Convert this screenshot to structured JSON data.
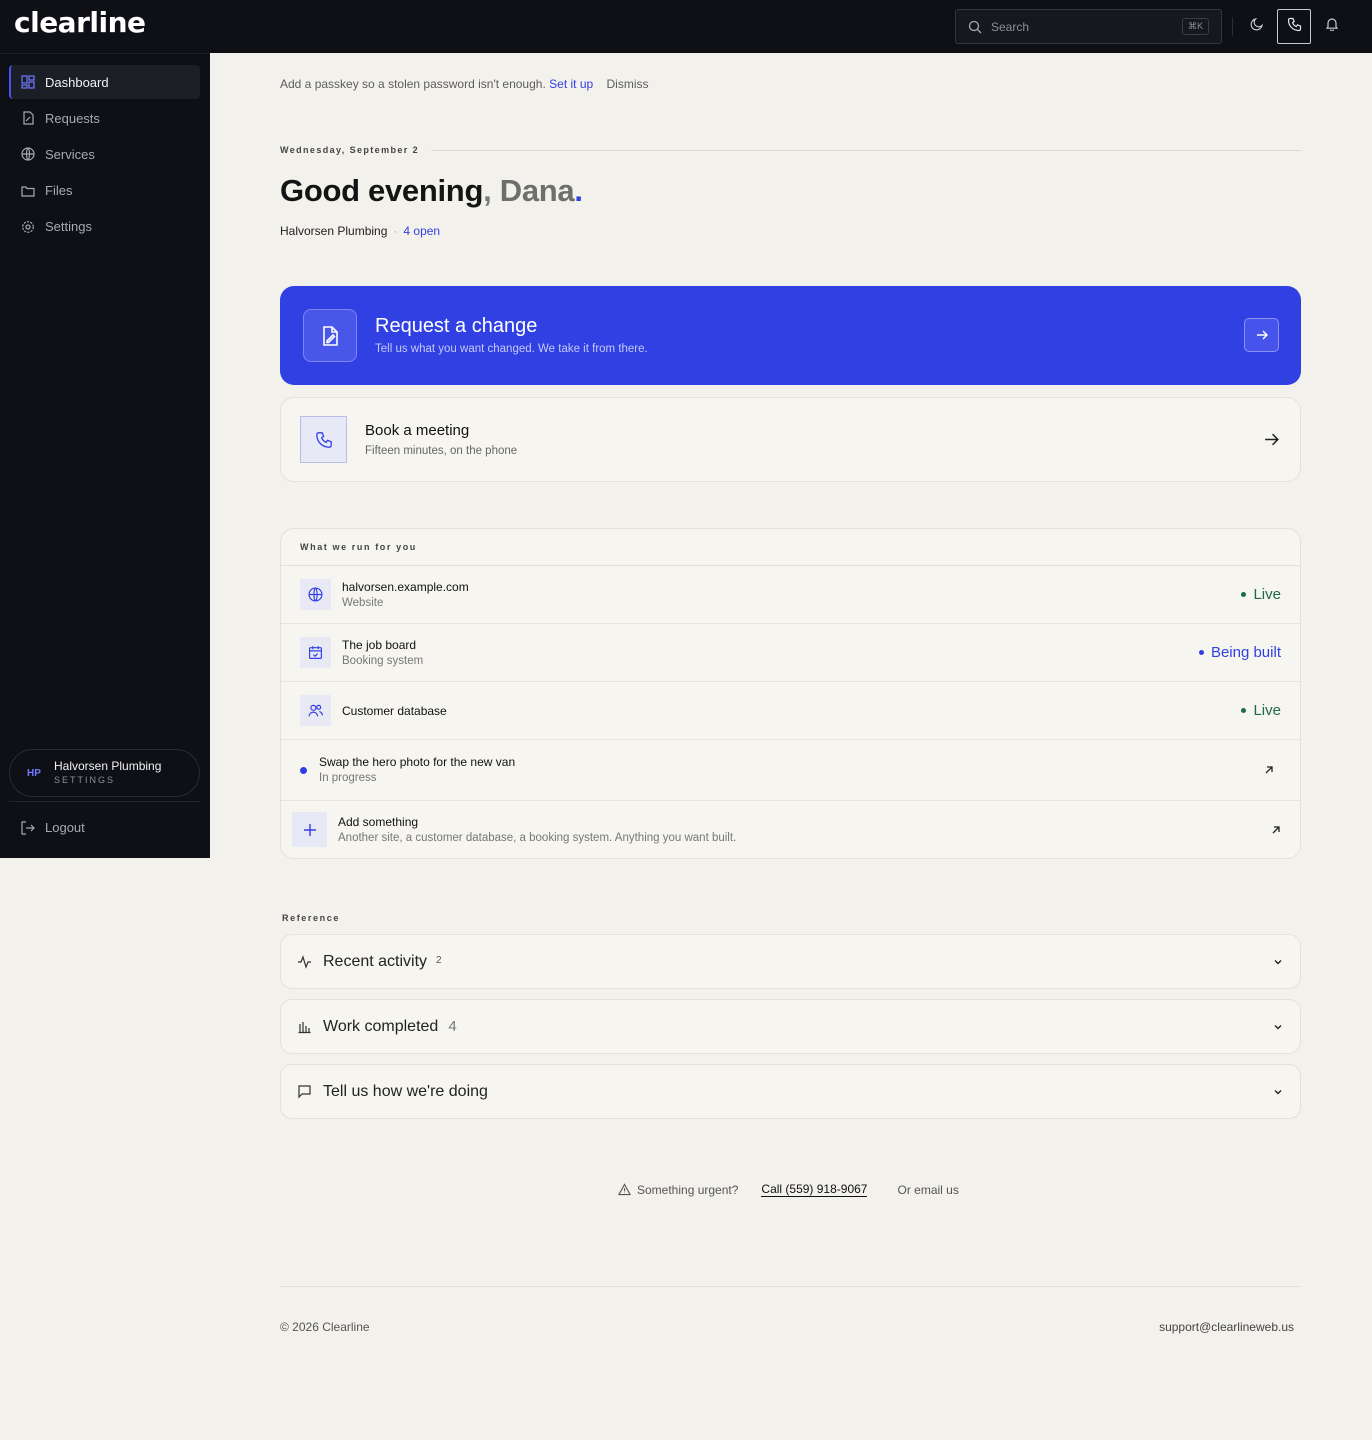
{
  "brand": {
    "logo": "clearline"
  },
  "sidebar": {
    "items": [
      {
        "label": "Dashboard",
        "icon": "dashboard-icon",
        "active": true
      },
      {
        "label": "Requests",
        "icon": "request-icon"
      },
      {
        "label": "Services",
        "icon": "globe-icon"
      },
      {
        "label": "Files",
        "icon": "folder-icon"
      },
      {
        "label": "Settings",
        "icon": "gear-icon"
      }
    ],
    "org": {
      "initials": "HP",
      "name": "Halvorsen Plumbing",
      "sub": "SETTINGS"
    },
    "logout": "Logout"
  },
  "topbar": {
    "search_placeholder": "Search",
    "search_shortcut": "⌘K"
  },
  "banner": {
    "text": "Add a passkey so a stolen password isn't enough.",
    "link": "Set it up",
    "dismiss": "Dismiss"
  },
  "header": {
    "date": "Wednesday, September 2",
    "greeting": "Good evening",
    "comma": ",",
    "name": "Dana",
    "dot": ".",
    "company": "Halvorsen Plumbing",
    "separator": "·",
    "open_count": "4 open"
  },
  "hero": {
    "title": "Request a change",
    "subtitle": "Tell us what you want changed. We take it from there."
  },
  "meeting": {
    "title": "Book a meeting",
    "subtitle": "Fifteen minutes, on the phone"
  },
  "services": {
    "heading": "What we run for you",
    "rows": [
      {
        "name": "halvorsen.example.com",
        "sub": "Website",
        "status": "Live",
        "icon": "globe-icon"
      },
      {
        "name": "The job board",
        "sub": "Booking system",
        "status": "Being built",
        "icon": "calendar-icon"
      },
      {
        "name": "Customer database",
        "sub": "",
        "status": "Live",
        "icon": "users-icon"
      }
    ],
    "task": {
      "name": "Swap the hero photo for the new van",
      "sub": "In progress"
    },
    "add": {
      "name": "Add something",
      "sub": "Another site, a customer database, a booking system. Anything you want built."
    }
  },
  "reference": {
    "label": "Reference",
    "items": [
      {
        "title": "Recent activity",
        "count": "2",
        "icon": "activity-icon"
      },
      {
        "title": "Work completed",
        "count": "4",
        "icon": "bar-chart-icon"
      },
      {
        "title": "Tell us how we're doing",
        "count": "",
        "icon": "message-icon"
      }
    ]
  },
  "urgent": {
    "text": "Something urgent?",
    "call": "Call (559) 918-9067",
    "email": "Or email us"
  },
  "footer": {
    "copyright": "© 2026 Clearline",
    "support": "support@clearlineweb.us"
  },
  "colors": {
    "accent": "#3040e3",
    "sidebar_bg": "#0e1015",
    "page_bg": "#f3f1eb",
    "live": "#1e6b44"
  }
}
